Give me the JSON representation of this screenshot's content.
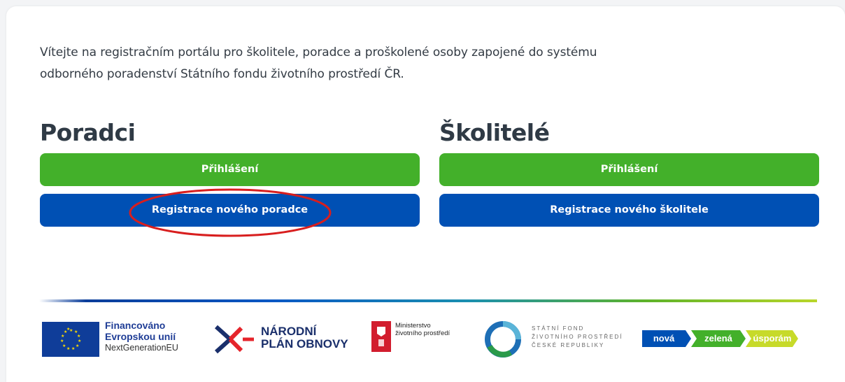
{
  "intro": {
    "line1": "Vítejte na registračním portálu pro školitele, poradce a proškolené osoby zapojené do systému",
    "line2": "odborného poradenství Státního fondu životního prostředí ČR."
  },
  "poradci": {
    "heading": "Poradci",
    "login_label": "Přihlášení",
    "register_label": "Registrace nového poradce"
  },
  "skolitele": {
    "heading": "Školitelé",
    "login_label": "Přihlášení",
    "register_label": "Registrace nového školitele"
  },
  "footer": {
    "eu": {
      "line1": "Financováno",
      "line2": "Evropskou unií",
      "line3": "NextGenerationEU"
    },
    "npo": {
      "line1": "NÁRODNÍ",
      "line2": "PLÁN OBNOVY"
    },
    "mzp": {
      "line1": "Ministerstvo",
      "line2": "životního prostředí"
    },
    "sfzp": {
      "line1": "STÁTNÍ FOND",
      "line2": "ŽIVOTNÍHO PROSTŘEDÍ",
      "line3": "ČESKÉ REPUBLIKY"
    },
    "nzu": {
      "seg1": "nová",
      "seg2": "zelená",
      "seg3": "úsporám"
    }
  },
  "colors": {
    "green_button": "#43b02a",
    "blue_button": "#0050b4",
    "highlight_ellipse": "#d81e1e"
  },
  "icons": [
    "eu-flag-icon",
    "npo-arrows-icon",
    "mzp-emblem-icon",
    "sfzp-ring-icon"
  ]
}
